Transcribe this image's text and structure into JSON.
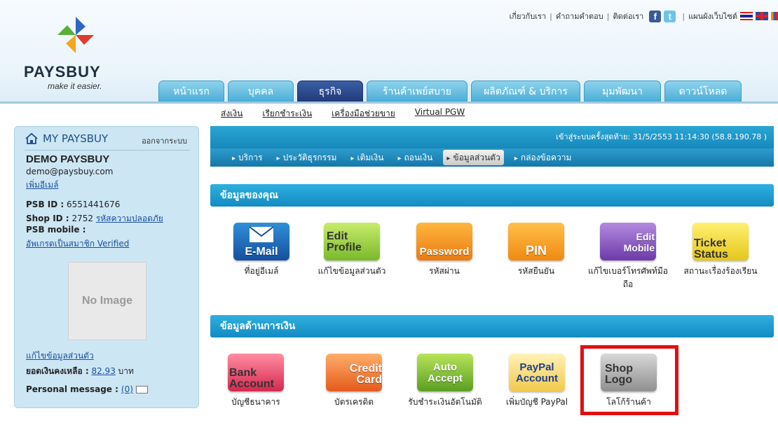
{
  "brand": {
    "name": "PAYSBUY",
    "tagline": "make it easier."
  },
  "top_links": [
    "เกี่ยวกับเรา",
    "คำถามคำตอบ",
    "ติดต่อเรา",
    "แผนผังเว็บไซต์"
  ],
  "main_tabs": [
    {
      "label": "หน้าแรก",
      "active": false
    },
    {
      "label": "บุคคล",
      "active": false
    },
    {
      "label": "ธุรกิจ",
      "active": true
    },
    {
      "label": "ร้านค้าเพย์สบาย",
      "active": false
    },
    {
      "label": "ผลิตภัณฑ์ & บริการ",
      "active": false
    },
    {
      "label": "มุมพัฒนา",
      "active": false
    },
    {
      "label": "ดาวน์โหลด",
      "active": false
    }
  ],
  "sub_nav": [
    "ส่งเงิน",
    "เรียกชำระเงิน",
    "เครื่องมือช่วยขาย",
    "Virtual PGW"
  ],
  "sidebar": {
    "title": "MY PAYSBUY",
    "logout": "ออกจากระบบ",
    "name": "DEMO PAYSBUY",
    "email": "demo@paysbuy.com",
    "add_email": "เพิ่มอีเมล์",
    "psb_id_label": "PSB ID :",
    "psb_id": "6551441676",
    "shop_id_label": "Shop ID :",
    "shop_id": "2752",
    "security_code": "รหัสความปลอดภัย",
    "psb_mobile_label": "PSB mobile :",
    "upgrade": "อัพเกรดเป็นสมาชิก Verified",
    "no_image": "No Image",
    "edit_profile": "แก้ไขข้อมูลส่วนตัว",
    "balance_label": "ยอดเงินคงเหลือ :",
    "balance": "82.93",
    "currency": "บาท",
    "message_label": "Personal message :",
    "message_count": "(0)"
  },
  "last_login": "เข้าสู่ระบบครั้งสุดท้าย: 31/5/2553 11:14:30 (58.8.190.78 )",
  "sub_tabs": [
    {
      "label": "บริการ",
      "active": false
    },
    {
      "label": "ประวัติธุรกรรม",
      "active": false
    },
    {
      "label": "เติมเงิน",
      "active": false
    },
    {
      "label": "ถอนเงิน",
      "active": false
    },
    {
      "label": "ข้อมูลส่วนตัว",
      "active": true
    },
    {
      "label": "กล่องข้อความ",
      "active": false
    }
  ],
  "section1": {
    "title": "ข้อมูลของคุณ",
    "items": [
      {
        "tile": "E-Mail",
        "label": "ที่อยู่อีเมล์",
        "icon": "email-icon"
      },
      {
        "tile": "Edit Profile",
        "label": "แก้ไขข้อมูลส่วนตัว",
        "icon": "edit-profile-icon"
      },
      {
        "tile": "Password",
        "label": "รหัสผ่าน",
        "icon": "password-icon"
      },
      {
        "tile": "PIN",
        "label": "รหัสยืนยัน",
        "icon": "pin-icon"
      },
      {
        "tile": "Edit Mobile",
        "label": "แก้ไขเบอร์โทรศัพท์มือถือ",
        "icon": "edit-mobile-icon"
      },
      {
        "tile": "Ticket Status",
        "label": "สถานะเรื่องร้องเรียน",
        "icon": "ticket-status-icon"
      }
    ]
  },
  "section2": {
    "title": "ข้อมูลด้านการเงิน",
    "items": [
      {
        "tile": "Bank Account",
        "label": "บัญชีธนาคาร",
        "icon": "bank-account-icon"
      },
      {
        "tile": "Credit Card",
        "label": "บัตรเครดิต",
        "icon": "credit-card-icon"
      },
      {
        "tile": "Auto Accept",
        "label": "รับชำระเงินอัตโนมัติ",
        "icon": "auto-accept-icon"
      },
      {
        "tile": "PayPal Account",
        "label": "เพิ่มบัญชี PayPal",
        "icon": "paypal-icon"
      },
      {
        "tile": "Shop Logo",
        "label": "โลโก้ร้านค้า",
        "icon": "shop-logo-icon"
      }
    ]
  },
  "colors": {
    "accent": "#1788bb",
    "active_tab": "#23397a",
    "highlight": "#e01010"
  }
}
